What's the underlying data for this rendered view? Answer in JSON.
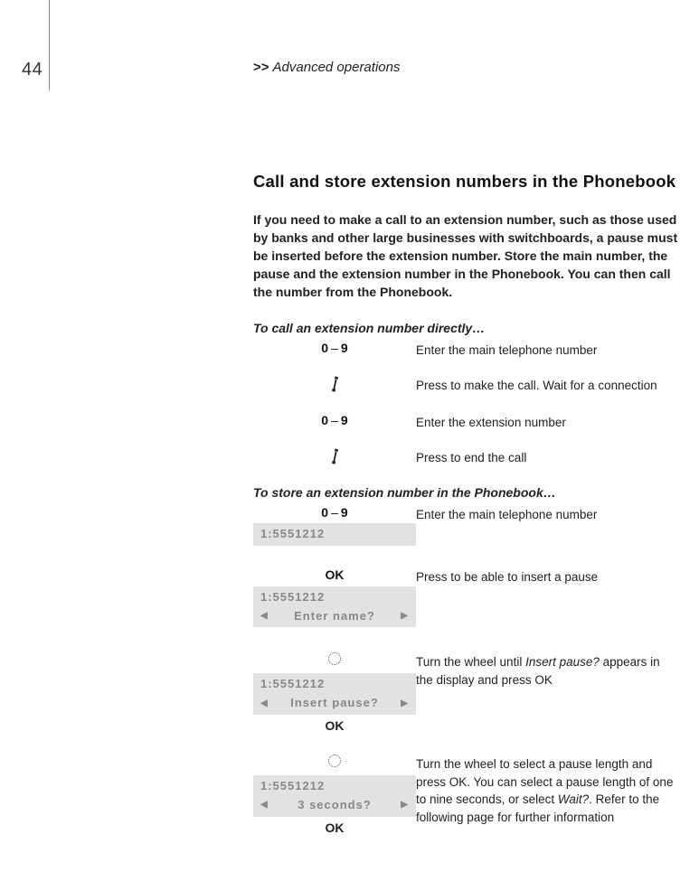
{
  "page_number": "44",
  "breadcrumb": {
    "chevrons": ">>",
    "label": "Advanced operations"
  },
  "heading": "Call and store extension numbers in the Phonebook",
  "intro": "If you need to make a call to an extension number, such as those used by banks and other large businesses with switchboards, a pause must be inserted before the extension number. Store the main number, the pause and the extension number in the Phonebook. You can then call the number from the Phonebook.",
  "section1": {
    "title": "To call an extension number directly…",
    "steps": [
      {
        "key_a": "0",
        "dash": "–",
        "key_b": "9",
        "desc": "Enter the main telephone number"
      },
      {
        "icon": "phone",
        "desc": "Press to make the call. Wait for a connection"
      },
      {
        "key_a": "0",
        "dash": "–",
        "key_b": "9",
        "desc": "Enter the extension number"
      },
      {
        "icon": "phone",
        "desc": "Press to end the call"
      }
    ]
  },
  "section2": {
    "title": "To store an extension number in the Phonebook…",
    "steps": [
      {
        "key_a": "0",
        "dash": "–",
        "key_b": "9",
        "lcd_line1": "1:5551212",
        "desc": "Enter the main telephone number"
      },
      {
        "ok_top": "OK",
        "lcd_line1": "1:5551212",
        "lcd_line2": "Enter name?",
        "desc": "Press to be able to insert a pause"
      },
      {
        "icon": "wheel",
        "lcd_line1": "1:5551212",
        "lcd_line2": "Insert pause?",
        "ok_bottom": "OK",
        "desc_pre": "Turn the wheel until ",
        "desc_italic": "Insert pause?",
        "desc_post": " appears in the display and press OK"
      },
      {
        "icon": "wheel",
        "lcd_line1": "1:5551212",
        "lcd_line2": "3 seconds?",
        "ok_bottom": "OK",
        "desc_pre": "Turn the wheel to select a pause length and press OK. You can select a pause length of one to nine seconds, or select ",
        "desc_italic": "Wait?",
        "desc_post": ". Refer to the following page for further information"
      }
    ]
  }
}
